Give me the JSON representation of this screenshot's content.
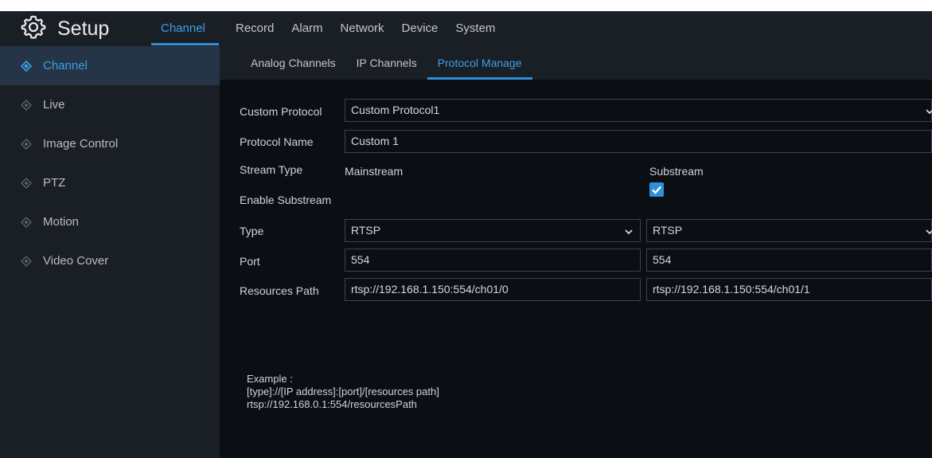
{
  "header": {
    "title": "Setup",
    "icon": "gear-icon",
    "tabs": [
      "Channel",
      "Record",
      "Alarm",
      "Network",
      "Device",
      "System"
    ],
    "active_tab": "Channel"
  },
  "sidebar": {
    "items": [
      {
        "label": "Channel",
        "active": true
      },
      {
        "label": "Live",
        "active": false
      },
      {
        "label": "Image Control",
        "active": false
      },
      {
        "label": "PTZ",
        "active": false
      },
      {
        "label": "Motion",
        "active": false
      },
      {
        "label": "Video Cover",
        "active": false
      }
    ]
  },
  "subtabs": {
    "items": [
      "Analog Channels",
      "IP Channels",
      "Protocol Manage"
    ],
    "active": "Protocol Manage"
  },
  "form": {
    "custom_protocol_label": "Custom Protocol",
    "custom_protocol_value": "Custom Protocol1",
    "protocol_name_label": "Protocol Name",
    "protocol_name_value": "Custom 1",
    "stream_type_label": "Stream Type",
    "mainstream_label": "Mainstream",
    "substream_label": "Substream",
    "enable_substream_label": "Enable Substream",
    "enable_substream_checked": true,
    "type_label": "Type",
    "main_type_value": "RTSP",
    "sub_type_value": "RTSP",
    "port_label": "Port",
    "main_port_value": "554",
    "sub_port_value": "554",
    "resources_path_label": "Resources Path",
    "main_path_value": "rtsp://192.168.1.150:554/ch01/0",
    "sub_path_value": "rtsp://192.168.1.150:554/ch01/1"
  },
  "example": {
    "line1": "Example :",
    "line2": "[type]://[IP address]:[port]/[resources path]",
    "line3": "rtsp://192.168.0.1:554/resourcesPath"
  },
  "colors": {
    "accent": "#2f8fd8",
    "panel": "#1a1f26",
    "background": "#0b0f14",
    "active_row": "#253447"
  }
}
